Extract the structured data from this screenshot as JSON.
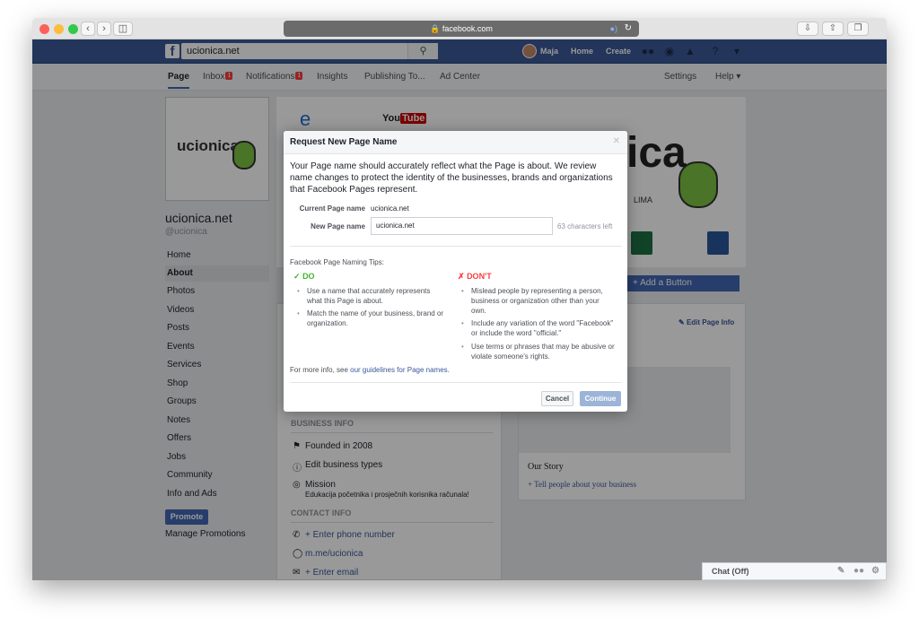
{
  "browser": {
    "url": "facebook.com"
  },
  "fb": {
    "search_value": "ucionica.net",
    "user_name": "Maja",
    "nav": [
      "Home",
      "Create"
    ]
  },
  "page_tabs": {
    "page": "Page",
    "inbox": "Inbox",
    "inbox_badge": "1",
    "notifications": "Notifications",
    "notifications_badge": "1",
    "insights": "Insights",
    "publishing": "Publishing To...",
    "ad_center": "Ad Center",
    "settings": "Settings",
    "help": "Help ▾"
  },
  "profile": {
    "logo_text": "ucionica",
    "name": "ucionica.net",
    "handle": "@ucionica"
  },
  "sidebar": {
    "items": [
      "Home",
      "About",
      "Photos",
      "Videos",
      "Posts",
      "Events",
      "Services",
      "Shop",
      "Groups",
      "Notes",
      "Offers",
      "Jobs",
      "Community",
      "Info and Ads"
    ],
    "promote": "Promote",
    "manage": "Manage Promotions"
  },
  "cover": {
    "logo_text": "ica",
    "tagline": "LIMA",
    "icons": [
      "You",
      "Tube"
    ]
  },
  "page_body": {
    "add_button": "+ Add a Button",
    "edit_page_info": "Edit Page Info",
    "business_info": "BUSINESS INFO",
    "founded": "Founded in 2008",
    "edit_business_types": "Edit business types",
    "mission_label": "Mission",
    "mission_text": "Edukacija početnika i prosječnih korisnika računala!",
    "contact_info": "CONTACT INFO",
    "phone": "+ Enter phone number",
    "messenger": "m.me/ucionica",
    "email": "+ Enter email",
    "our_story": "Our Story",
    "tell_people": "+ Tell people about your business"
  },
  "modal": {
    "title": "Request New Page Name",
    "description": "Your Page name should accurately reflect what the Page is about. We review name changes to protect the identity of the businesses, brands and organizations that Facebook Pages represent.",
    "current_label": "Current Page name",
    "current_value": "ucionica.net",
    "new_label": "New Page name",
    "new_value": "ucionica.net",
    "chars_left": "63 characters left",
    "tips_title": "Facebook Page Naming Tips:",
    "do_title": "DO",
    "do_rules": [
      "Use a name that accurately represents what this Page is about.",
      "Match the name of your business, brand or organization."
    ],
    "dont_title": "DON'T",
    "dont_rules": [
      "Mislead people by representing a person, business or organization other than your own.",
      "Include any variation of the word \"Facebook\" or include the word \"official.\"",
      "Use terms or phrases that may be abusive or violate someone's rights."
    ],
    "more_prefix": "For more info, see ",
    "more_link": "our guidelines for Page names",
    "more_suffix": ".",
    "cancel": "Cancel",
    "continue": "Continue"
  },
  "chat": {
    "label": "Chat (Off)"
  },
  "colors": {
    "fb_blue": "#3b5998",
    "button_blue": "#4267b2",
    "do_green": "#42b72a",
    "dont_red": "#fa3e3e",
    "continue_disabled": "#9cb4d8"
  }
}
